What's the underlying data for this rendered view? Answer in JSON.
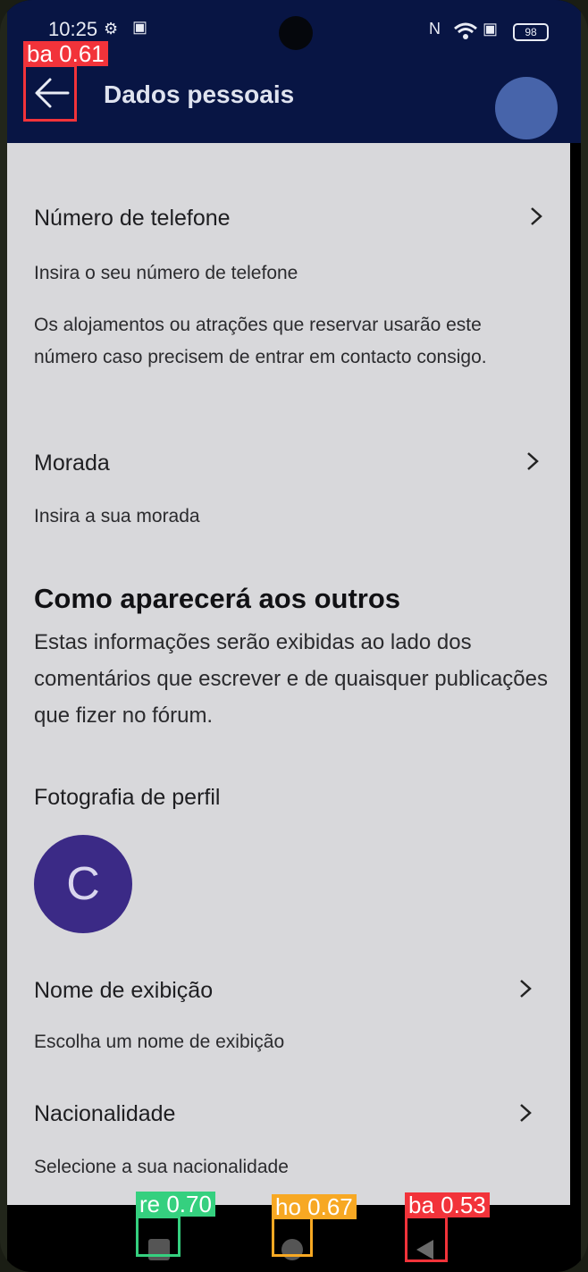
{
  "status": {
    "time": "10:25",
    "battery": "98"
  },
  "header": {
    "title": "Dados pessoais"
  },
  "rows": {
    "phone": {
      "title": "Número de telefone",
      "subtitle": "Insira o seu número de telefone",
      "description": "Os alojamentos ou atrações que reservar usarão este número caso precisem de entrar em contacto consigo."
    },
    "address": {
      "title": "Morada",
      "subtitle": "Insira a sua morada"
    },
    "display_name": {
      "title": "Nome de exibição",
      "subtitle": "Escolha um nome de exibição"
    },
    "nationality": {
      "title": "Nacionalidade",
      "subtitle": "Selecione a sua nacionalidade"
    }
  },
  "appearance": {
    "title": "Como aparecerá aos outros",
    "text": "Estas informações serão exibidas ao lado dos comentários que escrever e de quaisquer publicações que fizer no fórum.",
    "photo_label": "Fotografia de perfil",
    "avatar_initial": "C"
  },
  "detections": {
    "back_top": "ba 0.61",
    "recents": "re 0.70",
    "home": "ho 0.67",
    "back_nav": "ba 0.53"
  },
  "colors": {
    "header_bg": "#081544",
    "content_bg": "#d8d8db",
    "avatar": "#3b2a86",
    "det_red": "#f2333a",
    "det_green": "#35d07f",
    "det_orange": "#f7a823"
  }
}
